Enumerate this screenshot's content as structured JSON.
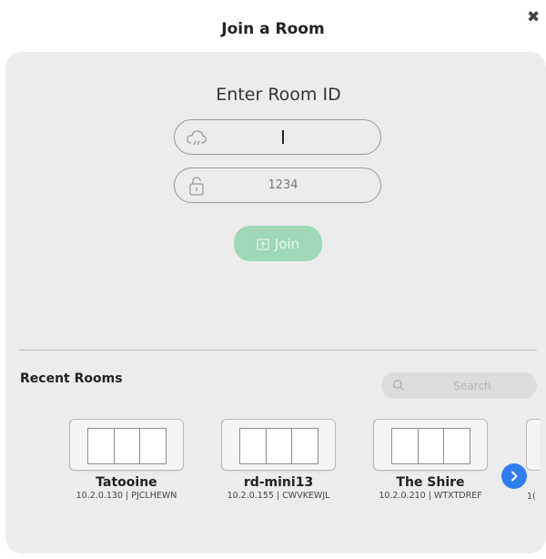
{
  "dialog": {
    "title": "Join a Room",
    "close_icon": "close-icon"
  },
  "join_form": {
    "heading": "Enter Room ID",
    "room_id": {
      "value": "",
      "icon": "cloud-icon"
    },
    "passcode": {
      "value": "1234",
      "icon": "lock-icon"
    },
    "join_label": "Join",
    "join_icon": "upload-icon"
  },
  "recent": {
    "heading": "Recent Rooms",
    "search_placeholder": "Search",
    "search_icon": "search-icon",
    "rooms": [
      {
        "name": "Tatooine",
        "meta": "10.2.0.130 | PJCLHEWN"
      },
      {
        "name": "rd-mini13",
        "meta": "10.2.0.155 | CWVKEWJL"
      },
      {
        "name": "The Shire",
        "meta": "10.2.0.210 | WTXTDREF"
      }
    ],
    "partial_meta": "1(",
    "next_icon": "chevron-right-icon"
  },
  "colors": {
    "panel": "#ececec",
    "join_button": "#9fd8b6",
    "next_button": "#2f7df0"
  }
}
